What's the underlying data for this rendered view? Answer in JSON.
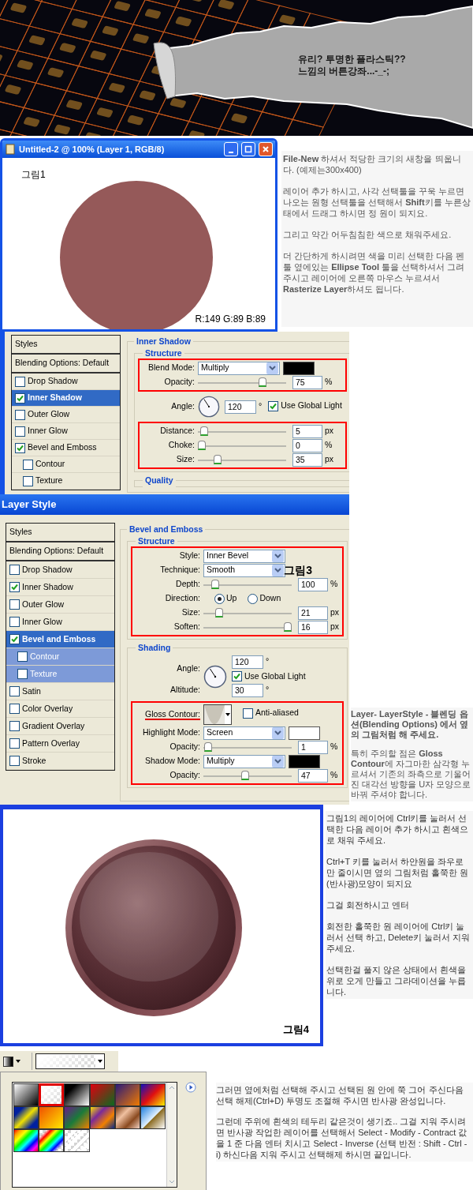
{
  "banner": {
    "title_lines": [
      "유리? 투명한 플라스틱??",
      "느낌의 버튼강좌...-_-;"
    ]
  },
  "step_1": {
    "window": {
      "title": "Untitled-2 @ 100% (Layer 1, RGB/8)",
      "caption": "그림1",
      "color_reading": "R:149 G:89 B:89"
    },
    "paragraphs": [
      "**File-New** 하셔서 적당한 크기의 새창을 띄웁니다. (예제는300x400)",
      "레이어 추가 하시고, 사각 선택툴을 꾸욱 누르면 나오는 원형 선택툴을 선택해서 **Shift**키를 누른상태에서 드래그 하시면 정 원이 되지요.",
      "그리고 약간 어두침침한 색으로 채워주세요.",
      "더 간단하게 하시려면 색을 미리 선택한 다음 펜툴 옆에있는 **Ellipse Tool** 툴을 선택하셔서 그려 주시고 레이어에 오른쪽 마우스 누르셔서**Rasterize Layer**하셔도 됩니다."
    ]
  },
  "inner_shadow_dialog": {
    "styles": [
      {
        "kind": "header",
        "label": "Styles"
      },
      {
        "kind": "header",
        "label": "Blending Options: Default"
      },
      {
        "kind": "effect",
        "label": "Drop Shadow",
        "checked": false,
        "selected": false
      },
      {
        "kind": "effect",
        "label": "Inner Shadow",
        "checked": true,
        "selected": true
      },
      {
        "kind": "effect",
        "label": "Outer Glow",
        "checked": false,
        "selected": false
      },
      {
        "kind": "effect",
        "label": "Inner Glow",
        "checked": false,
        "selected": false
      },
      {
        "kind": "effect",
        "label": "Bevel and Emboss",
        "checked": true,
        "selected": false
      },
      {
        "kind": "sub",
        "label": "Contour",
        "checked": false,
        "selected": false
      },
      {
        "kind": "sub",
        "label": "Texture",
        "checked": false,
        "selected": false
      }
    ],
    "panel": {
      "title": "Inner Shadow",
      "sections": [
        {
          "title": "Structure",
          "groups": [
            {
              "boxed": true,
              "rows": [
                {
                  "kind": "select",
                  "label": "Blend Mode:",
                  "value": "Multiply",
                  "color": "#000000"
                },
                {
                  "kind": "slider",
                  "label": "Opacity:",
                  "value": "75",
                  "unit": "%",
                  "level": 0.75
                }
              ]
            },
            {
              "boxed": false,
              "rows": [
                {
                  "kind": "angle",
                  "label": "Angle:",
                  "value": "120",
                  "unit": "°",
                  "option": {
                    "label": "Use Global Light",
                    "checked": true
                  }
                }
              ]
            },
            {
              "boxed": true,
              "rows": [
                {
                  "kind": "slider",
                  "label": "Distance:",
                  "value": "5",
                  "unit": "px",
                  "level": 0.03
                },
                {
                  "kind": "slider",
                  "label": "Choke:",
                  "value": "0",
                  "unit": "%",
                  "level": 0
                },
                {
                  "kind": "slider",
                  "label": "Size:",
                  "value": "35",
                  "unit": "px",
                  "level": 0.2
                }
              ]
            }
          ]
        },
        {
          "title": "Quality"
        }
      ]
    }
  },
  "layer_style_dialog": {
    "title": "Layer Style",
    "styles": [
      {
        "kind": "header",
        "label": "Styles"
      },
      {
        "kind": "header",
        "label": "Blending Options: Default"
      },
      {
        "kind": "effect",
        "label": "Drop Shadow",
        "checked": false,
        "selected": false
      },
      {
        "kind": "effect",
        "label": "Inner Shadow",
        "checked": true,
        "selected": false
      },
      {
        "kind": "effect",
        "label": "Outer Glow",
        "checked": false,
        "selected": false
      },
      {
        "kind": "effect",
        "label": "Inner Glow",
        "checked": false,
        "selected": false
      },
      {
        "kind": "effect",
        "label": "Bevel and Emboss",
        "checked": true,
        "selected": true
      },
      {
        "kind": "sub",
        "label": "Contour",
        "checked": false,
        "selected": false
      },
      {
        "kind": "sub",
        "label": "Texture",
        "checked": false,
        "selected": false
      },
      {
        "kind": "effect",
        "label": "Satin",
        "checked": false,
        "selected": false
      },
      {
        "kind": "effect",
        "label": "Color Overlay",
        "checked": false,
        "selected": false
      },
      {
        "kind": "effect",
        "label": "Gradient Overlay",
        "checked": false,
        "selected": false
      },
      {
        "kind": "effect",
        "label": "Pattern Overlay",
        "checked": false,
        "selected": false
      },
      {
        "kind": "effect",
        "label": "Stroke",
        "checked": false,
        "selected": false
      }
    ],
    "panel": {
      "title": "Bevel and Emboss",
      "sections": [
        {
          "title": "Structure",
          "groups": [
            {
              "boxed": true,
              "caption": "그림3",
              "rows": [
                {
                  "kind": "select",
                  "label": "Style:",
                  "value": "Inner Bevel"
                },
                {
                  "kind": "select",
                  "label": "Technique:",
                  "value": "Smooth"
                },
                {
                  "kind": "slider",
                  "label": "Depth:",
                  "value": "100",
                  "unit": "%",
                  "level": 0.1
                },
                {
                  "kind": "radio",
                  "label": "Direction:",
                  "options": [
                    {
                      "label": "Up",
                      "selected": true
                    },
                    {
                      "label": "Down",
                      "selected": false
                    }
                  ]
                },
                {
                  "kind": "slider",
                  "label": "Size:",
                  "value": "21",
                  "unit": "px",
                  "level": 0.15
                },
                {
                  "kind": "slider",
                  "label": "Soften:",
                  "value": "16",
                  "unit": "px",
                  "level": 1
                }
              ]
            }
          ]
        },
        {
          "title": "Shading",
          "groups": [
            {
              "boxed": false,
              "rows": [
                {
                  "kind": "angle_stacked",
                  "label": "Angle:",
                  "value": "120",
                  "unit": "°",
                  "option": {
                    "label": "Use Global Light",
                    "checked": true
                  }
                },
                {
                  "kind": "field",
                  "label": "Altitude:",
                  "value": "30",
                  "unit": "°"
                }
              ]
            },
            {
              "boxed": true,
              "rows": [
                {
                  "kind": "contour",
                  "label": "Gloss Contour:",
                  "underlined": true,
                  "option": {
                    "label": "Anti-aliased",
                    "checked": false
                  }
                },
                {
                  "kind": "select",
                  "label": "Highlight Mode:",
                  "value": "Screen",
                  "color": "#ffffff"
                },
                {
                  "kind": "slider",
                  "label": "Opacity:",
                  "value": "1",
                  "unit": "%",
                  "level": 0.01
                },
                {
                  "kind": "select",
                  "label": "Shadow Mode:",
                  "value": "Multiply",
                  "color": "#000000"
                },
                {
                  "kind": "slider",
                  "label": "Opacity:",
                  "value": "47",
                  "unit": "%",
                  "level": 0.47
                }
              ]
            }
          ]
        }
      ]
    },
    "paragraphs": [
      "**Layer- LayerStyle - 블렌딩 옵션(Blending Options) 에서 옆의 그림처럼 해 주세요.**",
      "특히 주의할 점은 **Gloss Contour**에 자그마한 삼각형 누르셔서 기존의 좌측으로 기울어진 대각선 방향을 U자 모양으로 바꿔 주셔야 합니다."
    ]
  },
  "step_4": {
    "caption": "그림4",
    "paragraphs": [
      "그림1의 레이어에 Ctrl키를 눌러서 선택한 다음 레이어 추가 하시고 흰색으로 채워 주세요.",
      "Ctrl+T 키를 눌러서 하얀원을 좌우로만 줄이시면 옆의 그림처럼 홀쭉한 원(반사광)모양이 되지요",
      "그걸 회전하시고 엔터",
      "회전한 홀쭉한 원 레이어에 Ctrl키 눌러서 선택 하고, Delete키 눌러서 지워 주세요.",
      "선택한걸 풀지 않은 상태에서 흰색을 위로 오게 만들고 그라데이션을 누릅니다."
    ]
  },
  "step_5": {
    "swatches": [
      {
        "selected": false
      },
      {
        "selected": true
      },
      {
        "selected": false
      },
      {
        "selected": false
      },
      {
        "selected": false
      },
      {
        "selected": false
      },
      {
        "selected": false
      },
      {
        "selected": false
      },
      {
        "selected": false
      },
      {
        "selected": false
      },
      {
        "selected": false
      },
      {
        "selected": false
      },
      {
        "selected": false
      },
      {
        "selected": false
      },
      {
        "selected": false
      }
    ],
    "paragraphs": [
      "그러면 옆에처럼 선택해 주시고 선택된 원 안에 쭉 그어 주신다음 선택 해제(Ctrl+D) 투명도 조절해 주시면 반사광 완성입니다.",
      "그런데 주위에 흰색의 테두리 같은것이 생기죠.. 그걸 지워 주시려면 반사광 작업한 레이어를 선택해서 Select - Modify - Contract 값을 1 준 다음 엔터 치시고 Select - Inverse (선택 반전 : Shift - Ctrl - i) 하신다음 지워 주시고 선택해제 하시면 끝입니다."
    ]
  }
}
